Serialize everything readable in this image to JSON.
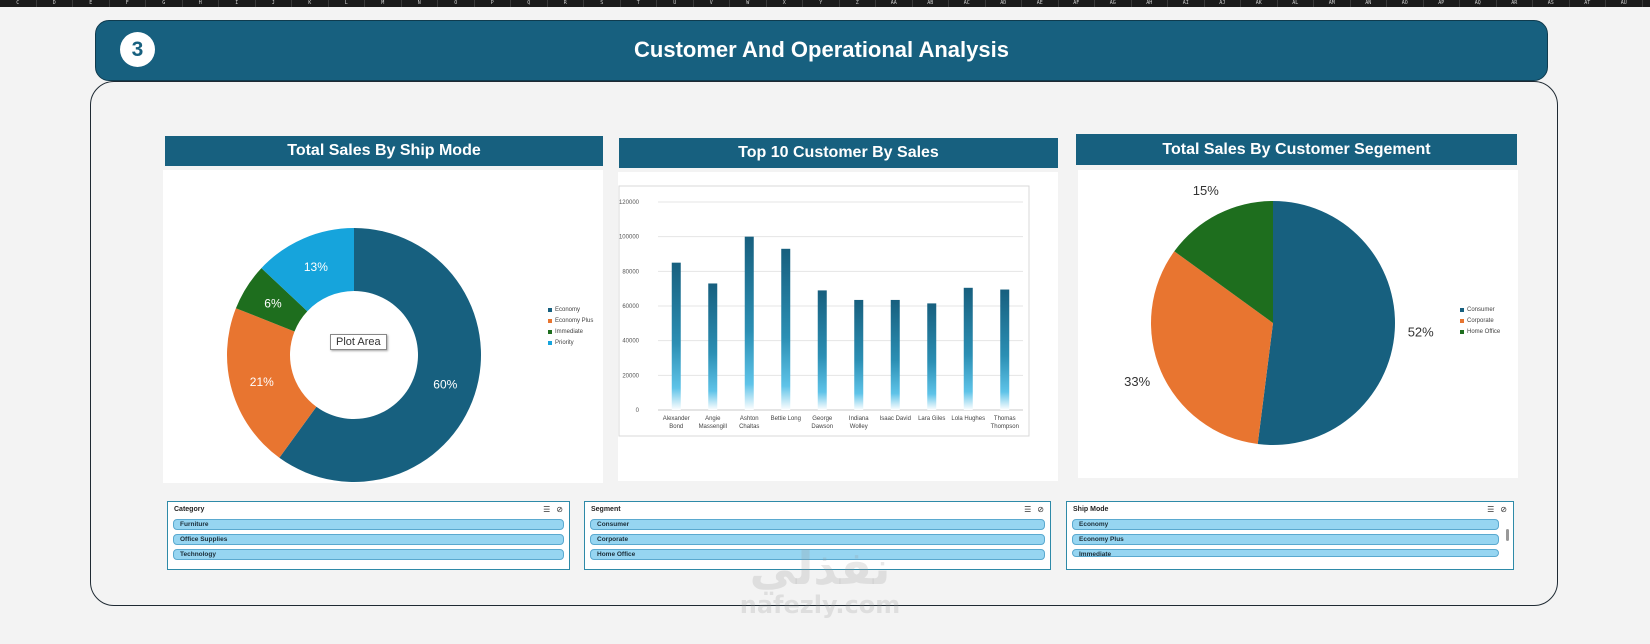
{
  "column_headers": [
    "C",
    "D",
    "E",
    "F",
    "G",
    "H",
    "I",
    "J",
    "K",
    "L",
    "M",
    "N",
    "O",
    "P",
    "Q",
    "R",
    "S",
    "T",
    "U",
    "V",
    "W",
    "X",
    "Y",
    "Z",
    "AA",
    "AB",
    "AC",
    "AD",
    "AE",
    "AF",
    "AG",
    "AH",
    "AI",
    "AJ",
    "AK",
    "AL",
    "AM",
    "AN",
    "AO",
    "AP",
    "AQ",
    "AR",
    "AS",
    "AT",
    "AU",
    "AV"
  ],
  "header": {
    "badge": "3",
    "title": "Customer And Operational Analysis"
  },
  "tooltip": "Plot Area",
  "colors": {
    "header": "#17607f",
    "economy": "#17607f",
    "economy_plus": "#e87530",
    "immediate": "#1e6e1e",
    "priority": "#16a4dc"
  },
  "charts": {
    "ship_mode": {
      "title": "Total Sales By Ship Mode"
    },
    "top_customers": {
      "title": "Top 10 Customer By Sales"
    },
    "segment": {
      "title": "Total Sales By Customer Segement"
    }
  },
  "chart_data": [
    {
      "type": "pie",
      "variant": "donut",
      "title": "Total Sales By Ship Mode",
      "categories": [
        "Economy",
        "Economy Plus",
        "Immediate",
        "Priority"
      ],
      "values": [
        60,
        21,
        6,
        13
      ],
      "labels": [
        "60%",
        "21%",
        "6%",
        "13%"
      ],
      "colors": [
        "#17607f",
        "#e87530",
        "#1e6e1e",
        "#16a4dc"
      ],
      "legend": "right"
    },
    {
      "type": "bar",
      "title": "Top 10 Customer By Sales",
      "categories": [
        [
          "Alexander",
          "Bond"
        ],
        [
          "Angie",
          "Massengill"
        ],
        [
          "Ashton",
          "Chaltas"
        ],
        [
          "Bettie Long"
        ],
        [
          "George",
          "Dawson"
        ],
        [
          "Indiana",
          "Wolley"
        ],
        [
          "Isaac David"
        ],
        [
          "Lara Giles"
        ],
        [
          "Lola Hughes"
        ],
        [
          "Thomas",
          "Thompson"
        ]
      ],
      "values": [
        85000,
        73000,
        100000,
        93000,
        69000,
        63500,
        63500,
        61500,
        70500,
        69500
      ],
      "yticks": [
        "0",
        "20000",
        "40000",
        "60000",
        "80000",
        "100000",
        "120000"
      ],
      "ylim": [
        0,
        120000
      ],
      "grid": true
    },
    {
      "type": "pie",
      "title": "Total Sales By Customer Segement",
      "categories": [
        "Consumer",
        "Corporate",
        "Home Office"
      ],
      "values": [
        52,
        33,
        15
      ],
      "labels": [
        "52%",
        "33%",
        "15%"
      ],
      "colors": [
        "#17607f",
        "#e87530",
        "#1e6e1e"
      ],
      "legend": "right"
    }
  ],
  "slicers": [
    {
      "title": "Category",
      "items": [
        "Furniture",
        "Office Supplies",
        "Technology"
      ]
    },
    {
      "title": "Segment",
      "items": [
        "Consumer",
        "Corporate",
        "Home Office"
      ]
    },
    {
      "title": "Ship Mode",
      "items": [
        "Economy",
        "Economy Plus",
        "Immediate"
      ]
    }
  ],
  "watermark": {
    "arabic": "نفذلي",
    "latin": "nafezly.com"
  }
}
